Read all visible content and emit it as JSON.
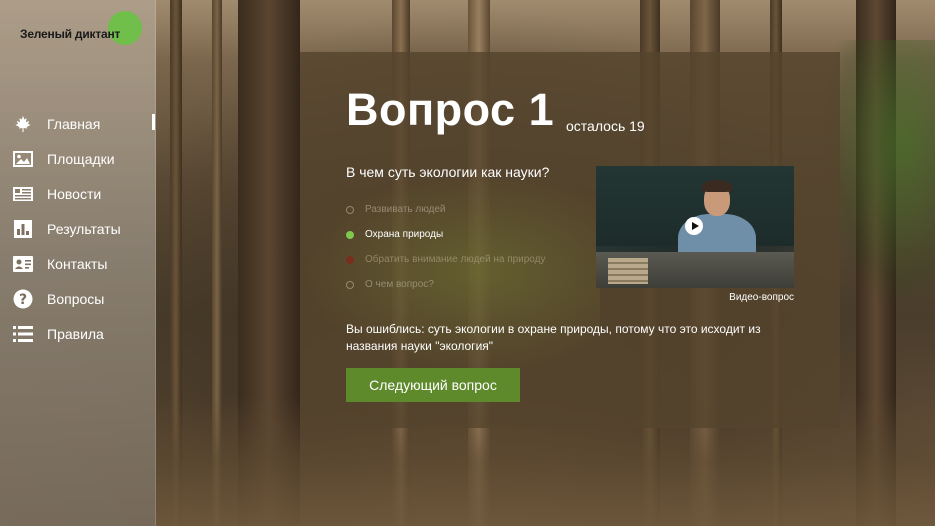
{
  "app": {
    "logo_text": "Зеленый диктант"
  },
  "sidebar": {
    "items": [
      {
        "label": "Главная",
        "icon": "maple-leaf-icon",
        "active": true
      },
      {
        "label": "Площадки",
        "icon": "image-icon",
        "active": false
      },
      {
        "label": "Новости",
        "icon": "news-icon",
        "active": false
      },
      {
        "label": "Результаты",
        "icon": "bar-chart-icon",
        "active": false
      },
      {
        "label": "Контакты",
        "icon": "contact-card-icon",
        "active": false
      },
      {
        "label": "Вопросы",
        "icon": "question-circle-icon",
        "active": false
      },
      {
        "label": "Правила",
        "icon": "list-icon",
        "active": false
      }
    ]
  },
  "question": {
    "title": "Вопрос 1",
    "remaining": "осталось 19",
    "text": "В чем суть экологии как науки?",
    "options": [
      {
        "label": "Развивать людей",
        "state": "unselected"
      },
      {
        "label": "Охрана природы",
        "state": "correct"
      },
      {
        "label": "Обратить внимание людей на природу",
        "state": "wrong"
      },
      {
        "label": "О чем вопрос?",
        "state": "unselected"
      }
    ],
    "video_caption": "Видео-вопрос",
    "explanation": "Вы ошиблись: суть экологии в охране природы, потому что это исходит из названия науки \"экология\"",
    "next_button": "Следующий вопрос"
  },
  "colors": {
    "accent": "#6fbf4a",
    "button": "#5e8a2c",
    "correct_dot": "#7ec850",
    "wrong_dot": "#7a2e1e"
  }
}
